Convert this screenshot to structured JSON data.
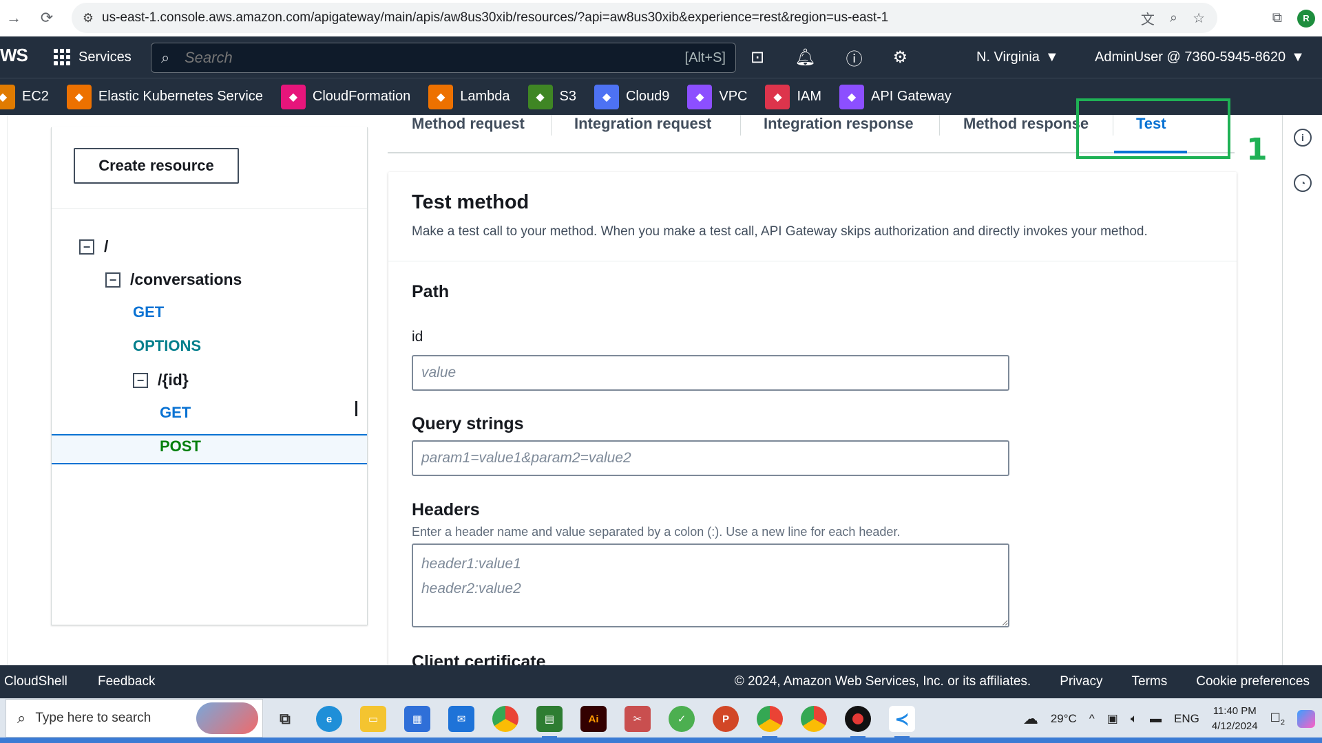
{
  "browser": {
    "url": "us-east-1.console.aws.amazon.com/apigateway/main/apis/aw8us30xib/resources/?api=aw8us30xib&experience=rest&region=us-east-1",
    "profile_initial": "R"
  },
  "aws_nav": {
    "logo": "WS",
    "services_label": "Services",
    "search_placeholder": "Search",
    "search_shortcut": "[Alt+S]",
    "region": "N. Virginia",
    "account": "AdminUser @ 7360-5945-8620"
  },
  "favorites": [
    {
      "label": "EC2",
      "color": "#e07b00",
      "icon": "ec2-icon"
    },
    {
      "label": "Elastic Kubernetes Service",
      "color": "#ed7100",
      "icon": "eks-icon"
    },
    {
      "label": "CloudFormation",
      "color": "#e7157b",
      "icon": "cloudformation-icon"
    },
    {
      "label": "Lambda",
      "color": "#ed7100",
      "icon": "lambda-icon"
    },
    {
      "label": "S3",
      "color": "#3f8624",
      "icon": "s3-icon"
    },
    {
      "label": "Cloud9",
      "color": "#4d72f3",
      "icon": "cloud9-icon"
    },
    {
      "label": "VPC",
      "color": "#8c4fff",
      "icon": "vpc-icon"
    },
    {
      "label": "IAM",
      "color": "#dd344c",
      "icon": "iam-icon"
    },
    {
      "label": "API Gateway",
      "color": "#8c4fff",
      "icon": "api-gateway-icon"
    }
  ],
  "left_panel": {
    "create_button": "Create resource",
    "tree": {
      "root": "/",
      "conversations": "/conversations",
      "conv_get": "GET",
      "conv_options": "OPTIONS",
      "id": "/{id}",
      "id_get": "GET",
      "id_post": "POST"
    }
  },
  "tabs": {
    "method_request": "Method request",
    "integration_request": "Integration request",
    "integration_response": "Integration response",
    "method_response": "Method response",
    "test": "Test",
    "annotation": "1"
  },
  "test_method": {
    "title": "Test method",
    "description": "Make a test call to your method. When you make a test call, API Gateway skips authorization and directly invokes your method.",
    "path_title": "Path",
    "id_label": "id",
    "id_placeholder": "value",
    "query_title": "Query strings",
    "query_placeholder": "param1=value1&param2=value2",
    "headers_title": "Headers",
    "headers_help": "Enter a header name and value separated by a colon (:). Use a new line for each header.",
    "headers_placeholder": "header1:value1\nheader2:value2",
    "client_cert_title": "Client certificate"
  },
  "footer": {
    "cloudshell": "CloudShell",
    "feedback": "Feedback",
    "copyright": "© 2024, Amazon Web Services, Inc. or its affiliates.",
    "privacy": "Privacy",
    "terms": "Terms",
    "cookies": "Cookie preferences"
  },
  "taskbar": {
    "search_placeholder": "Type here to search",
    "temperature": "29°C",
    "language": "ENG",
    "time": "11:40 PM",
    "date": "4/12/2024",
    "notifications": "2"
  }
}
